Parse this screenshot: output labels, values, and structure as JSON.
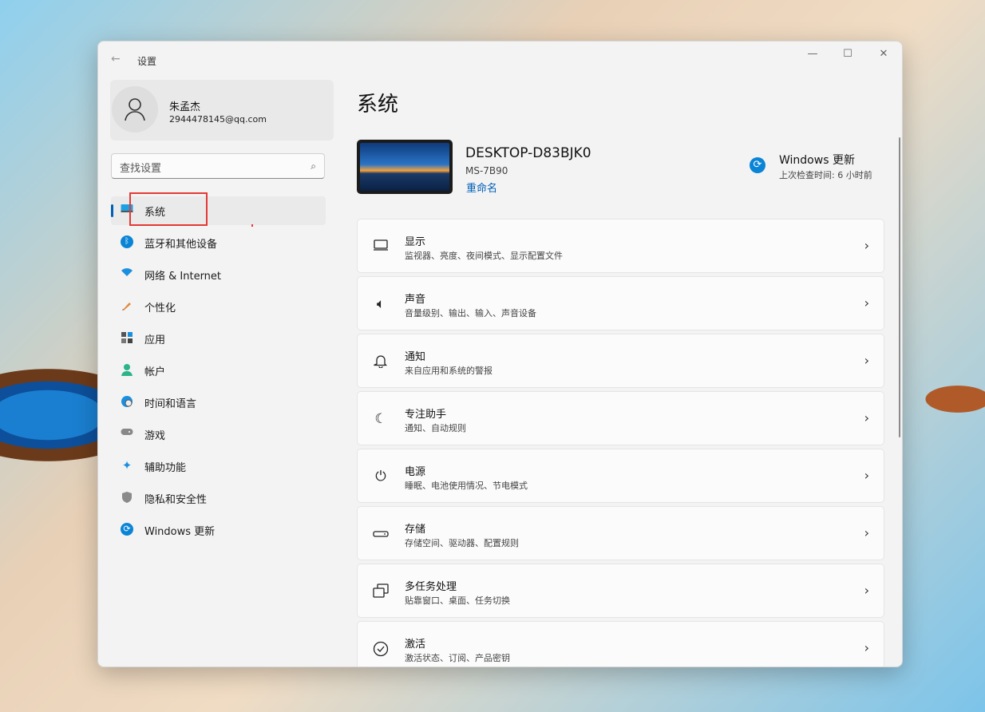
{
  "window": {
    "title": "设置",
    "back": "←",
    "minimize": "—",
    "maximize": "☐",
    "close": "✕"
  },
  "user": {
    "name": "朱孟杰",
    "email": "2944478145@qq.com"
  },
  "search": {
    "placeholder": "查找设置"
  },
  "nav": [
    {
      "label": "系统",
      "icon": "monitor-icon",
      "selected": true
    },
    {
      "label": "蓝牙和其他设备",
      "icon": "bluetooth-icon"
    },
    {
      "label": "网络 & Internet",
      "icon": "wifi-icon"
    },
    {
      "label": "个性化",
      "icon": "brush-icon"
    },
    {
      "label": "应用",
      "icon": "apps-icon"
    },
    {
      "label": "帐户",
      "icon": "account-icon"
    },
    {
      "label": "时间和语言",
      "icon": "globe-clock-icon"
    },
    {
      "label": "游戏",
      "icon": "gamepad-icon"
    },
    {
      "label": "辅助功能",
      "icon": "accessibility-icon"
    },
    {
      "label": "隐私和安全性",
      "icon": "shield-icon"
    },
    {
      "label": "Windows 更新",
      "icon": "update-icon"
    }
  ],
  "main": {
    "title": "系统",
    "device": {
      "name": "DESKTOP-D83BJK0",
      "model": "MS-7B90",
      "rename": "重命名"
    },
    "update": {
      "title": "Windows 更新",
      "subtitle": "上次检查时间: 6 小时前"
    },
    "cards": [
      {
        "title": "显示",
        "subtitle": "监视器、亮度、夜间模式、显示配置文件",
        "icon": "display-icon"
      },
      {
        "title": "声音",
        "subtitle": "音量级别、输出、输入、声音设备",
        "icon": "speaker-icon"
      },
      {
        "title": "通知",
        "subtitle": "来自应用和系统的警报",
        "icon": "bell-icon"
      },
      {
        "title": "专注助手",
        "subtitle": "通知、自动规则",
        "icon": "moon-icon"
      },
      {
        "title": "电源",
        "subtitle": "睡眠、电池使用情况、节电模式",
        "icon": "power-icon"
      },
      {
        "title": "存储",
        "subtitle": "存储空间、驱动器、配置规则",
        "icon": "storage-icon"
      },
      {
        "title": "多任务处理",
        "subtitle": "贴靠窗口、桌面、任务切换",
        "icon": "multitask-icon"
      },
      {
        "title": "激活",
        "subtitle": "激活状态、订阅、产品密钥",
        "icon": "check-circle-icon"
      }
    ]
  },
  "colors": {
    "accent": "#005fb8",
    "highlight": "#e53935"
  }
}
